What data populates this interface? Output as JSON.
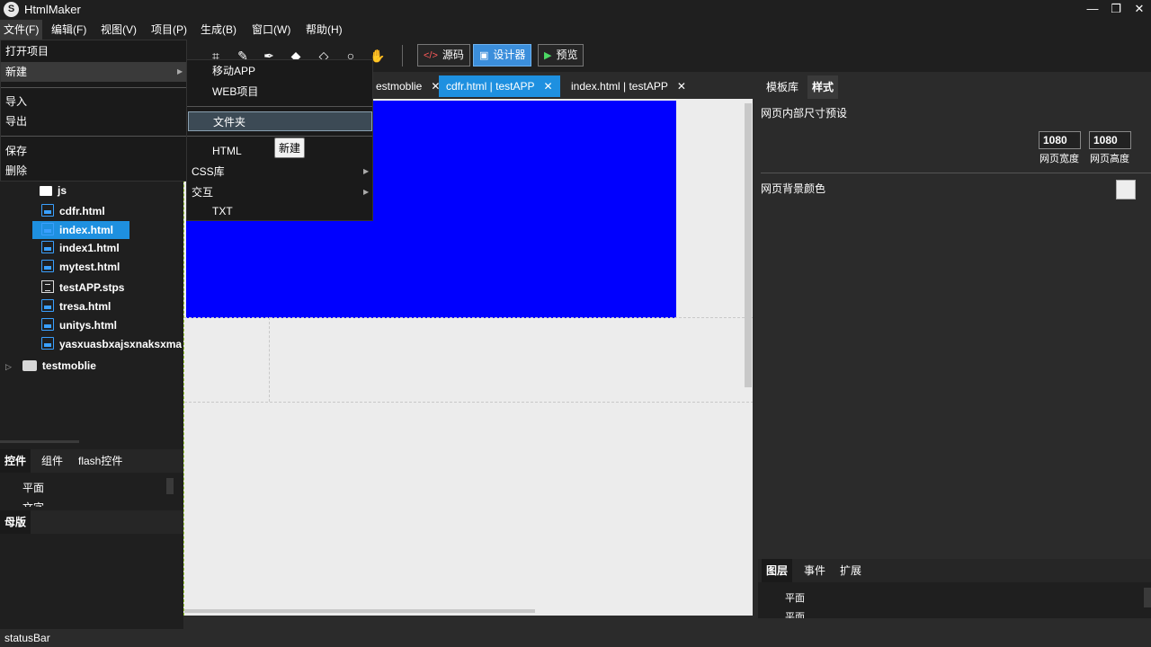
{
  "app": {
    "title": "HtmlMaker",
    "logo_char": "S"
  },
  "window_controls": {
    "minimize": "—",
    "restore": "❐",
    "close": "✕"
  },
  "menubar": {
    "file": "文件(F)",
    "edit": "编辑(F)",
    "view": "视图(V)",
    "project": "项目(P)",
    "generate": "生成(B)",
    "window": "窗口(W)",
    "help": "帮助(H)"
  },
  "toolbar": {
    "source_label": "源码",
    "designer_label": "设计器",
    "preview_label": "预览",
    "icons": [
      "crop-icon",
      "eyedropper-icon",
      "pen-icon",
      "fill-icon",
      "eraser-icon",
      "zoom-icon",
      "hand-icon"
    ]
  },
  "file_menu": {
    "open_project": "打开项目",
    "new": "新建",
    "import": "导入",
    "export": "导出",
    "save": "保存",
    "delete": "删除"
  },
  "new_submenu": {
    "mobile_app": "移动APP",
    "web_project": "WEB项目",
    "folder": "文件夹",
    "html": "HTML",
    "css_lib": "CSS库",
    "interaction": "交互",
    "txt": "TXT"
  },
  "tooltip": "新建",
  "tree": {
    "items": [
      {
        "label": "js",
        "type": "folder"
      },
      {
        "label": "cdfr.html",
        "type": "html"
      },
      {
        "label": "index.html",
        "type": "html",
        "selected": true
      },
      {
        "label": "index1.html",
        "type": "html"
      },
      {
        "label": "mytest.html",
        "type": "html"
      },
      {
        "label": "testAPP.stps",
        "type": "doc"
      },
      {
        "label": "tresa.html",
        "type": "html"
      },
      {
        "label": "unitys.html",
        "type": "html"
      },
      {
        "label": "yasxuasbxajsxnaksxmal",
        "type": "html"
      }
    ],
    "project2": "testmoblie",
    "expand_arrow": "▷"
  },
  "controls_panel": {
    "tabs": [
      "控件",
      "组件",
      "flash控件"
    ],
    "items": [
      "平面",
      "文字"
    ]
  },
  "master_panel": {
    "title": "母版"
  },
  "editor_tabs": [
    {
      "label": "estmoblie",
      "active": false
    },
    {
      "label": "cdfr.html | testAPP",
      "active": true
    },
    {
      "label": "index.html | testAPP",
      "active": false
    }
  ],
  "close_glyph": "✕",
  "right_panel": {
    "tabs": [
      "模板库",
      "样式"
    ],
    "size_preset_title": "网页内部尺寸预设",
    "width_value": "1080",
    "width_label": "网页宽度",
    "height_value": "1080",
    "height_label": "网页高度",
    "bg_color_label": "网页背景颜色",
    "bg_color": "#eeeeee",
    "bottom_tabs": [
      "图层",
      "事件",
      "扩展"
    ],
    "layer_items": [
      "平面",
      "平面"
    ]
  },
  "colors": {
    "accent": "#1e90e0",
    "canvas_block": "#0000ff",
    "preview_green": "#4cd964"
  },
  "statusbar": {
    "text": "statusBar"
  }
}
